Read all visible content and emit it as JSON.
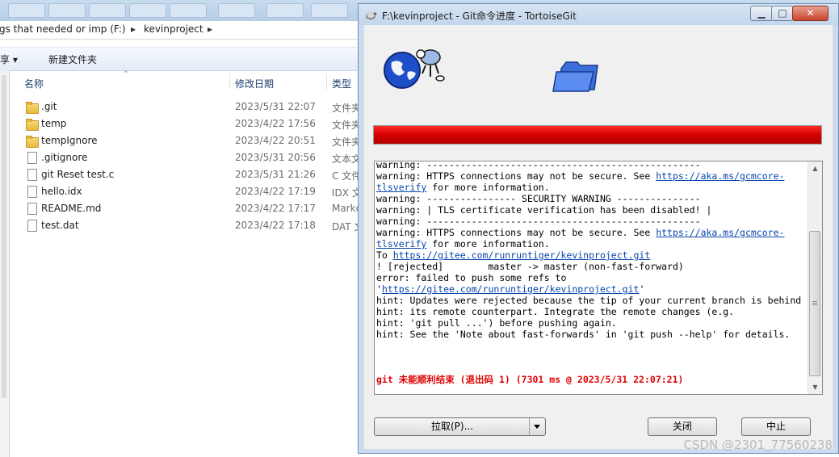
{
  "explorer": {
    "breadcrumb": [
      "gs that needed or imp (F:)",
      "kevinproject"
    ],
    "toolbar": {
      "share_label": "共享 ▾",
      "new_folder_label": "新建文件夹"
    },
    "columns": {
      "name": "名称",
      "date": "修改日期",
      "type": "类型"
    },
    "files": [
      {
        "name": ".git",
        "date": "2023/5/31 22:07",
        "type": "文件夹",
        "kind": "folder"
      },
      {
        "name": "temp",
        "date": "2023/4/22 17:56",
        "type": "文件夹",
        "kind": "folder"
      },
      {
        "name": "tempIgnore",
        "date": "2023/4/22 20:51",
        "type": "文件夹",
        "kind": "folder"
      },
      {
        "name": ".gitignore",
        "date": "2023/5/31 20:56",
        "type": "文本文档",
        "kind": "file"
      },
      {
        "name": "git Reset test.c",
        "date": "2023/5/31 21:26",
        "type": "C 文件",
        "kind": "file"
      },
      {
        "name": "hello.idx",
        "date": "2023/4/22 17:19",
        "type": "IDX 文件",
        "kind": "file"
      },
      {
        "name": "README.md",
        "date": "2023/4/22 17:17",
        "type": "Markdown",
        "kind": "file"
      },
      {
        "name": "test.dat",
        "date": "2023/4/22 17:18",
        "type": "DAT 文件",
        "kind": "file"
      }
    ]
  },
  "dialog": {
    "title": "F:\\kevinproject - Git命令进度 - TortoiseGit",
    "window_buttons": {
      "minimize": "▁",
      "maximize": "□",
      "close": "✕"
    },
    "progress": {
      "fraction": 1.0,
      "state": "error",
      "color": "#d40000"
    },
    "log": [
      [
        {
          "t": "warning: -------------------------------------------------"
        }
      ],
      [
        {
          "t": "warning: HTTPS connections may not be secure. See "
        },
        {
          "t": "https://aka.ms/gcmcore-",
          "link": true
        }
      ],
      [
        {
          "t": "tlsverify",
          "link": true
        },
        {
          "t": " for more information."
        }
      ],
      [
        {
          "t": "warning: ---------------- SECURITY WARNING ---------------"
        }
      ],
      [
        {
          "t": "warning: | TLS certificate verification has been disabled! |"
        }
      ],
      [
        {
          "t": "warning: -------------------------------------------------"
        }
      ],
      [
        {
          "t": "warning: HTTPS connections may not be secure. See "
        },
        {
          "t": "https://aka.ms/gcmcore-",
          "link": true
        }
      ],
      [
        {
          "t": "tlsverify",
          "link": true
        },
        {
          "t": " for more information."
        }
      ],
      [
        {
          "t": "To "
        },
        {
          "t": "https://gitee.com/runruntiger/kevinproject.git",
          "link": true
        }
      ],
      [
        {
          "t": "! [rejected]        master -> master (non-fast-forward)"
        }
      ],
      [
        {
          "t": "error: failed to push some refs to"
        }
      ],
      [
        {
          "t": "'"
        },
        {
          "t": "https://gitee.com/runruntiger/kevinproject.git",
          "link": true
        },
        {
          "t": "'"
        }
      ],
      [
        {
          "t": "hint: Updates were rejected because the tip of your current branch is behind"
        }
      ],
      [
        {
          "t": "hint: its remote counterpart. Integrate the remote changes (e.g."
        }
      ],
      [
        {
          "t": "hint: 'git pull ...') before pushing again."
        }
      ],
      [
        {
          "t": "hint: See the 'Note about fast-forwards' in 'git push --help' for details."
        }
      ]
    ],
    "result_line": "git 未能顺利结束 (退出码 1) (7301 ms @ 2023/5/31 22:07:21)",
    "buttons": {
      "pull": "拉取(P)...",
      "close": "关闭",
      "abort": "中止"
    }
  },
  "watermark": "CSDN @2301_77560238"
}
